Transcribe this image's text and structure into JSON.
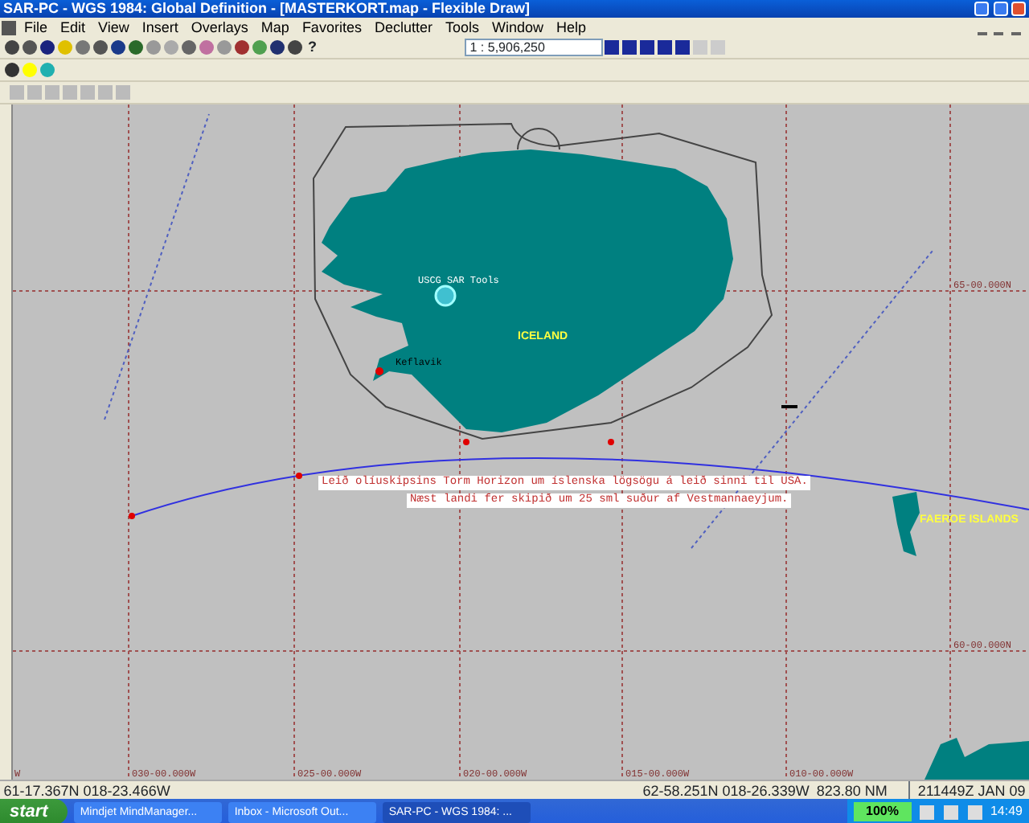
{
  "window": {
    "title": "SAR-PC - WGS 1984: Global Definition - [MASTERKORT.map - Flexible Draw]"
  },
  "menu": [
    "File",
    "Edit",
    "View",
    "Insert",
    "Overlays",
    "Map",
    "Favorites",
    "Declutter",
    "Tools",
    "Window",
    "Help"
  ],
  "toolbar": {
    "help_button": "?",
    "scale": "1 : 5,906,250"
  },
  "map": {
    "lat_labels": [
      "65-00.000N",
      "60-00.000N"
    ],
    "lon_labels": [
      "W",
      "030-00.000W",
      "025-00.000W",
      "020-00.000W",
      "015-00.000W",
      "010-00.000W"
    ],
    "places": [
      {
        "label": "USCG SAR Tools",
        "kind": "marker"
      },
      {
        "label": "ICELAND",
        "kind": "country"
      },
      {
        "label": "Keflavik",
        "kind": "airport"
      },
      {
        "label": "FAEROE ISLANDS",
        "kind": "country"
      }
    ],
    "annotation": [
      "Leið olíuskipsins Torm Horizon um íslenska lögsögu á leið sinni til USA.",
      "Næst landi fer skipið um 25 sml suður af Vestmannaeyjum."
    ]
  },
  "status_bar": {
    "cursor": "61-17.367N 018-23.466W",
    "route_end": "62-58.251N 018-26.339W",
    "distance": "823.80 NM",
    "time": "211449Z JAN 09"
  },
  "taskbar": {
    "start": "start",
    "tasks": [
      {
        "label": "Mindjet MindManager...",
        "selected": false
      },
      {
        "label": "Inbox - Microsoft Out...",
        "selected": false
      },
      {
        "label": "SAR-PC - WGS 1984: ...",
        "selected": true
      }
    ],
    "battery": "100%",
    "clock": "14:49"
  }
}
